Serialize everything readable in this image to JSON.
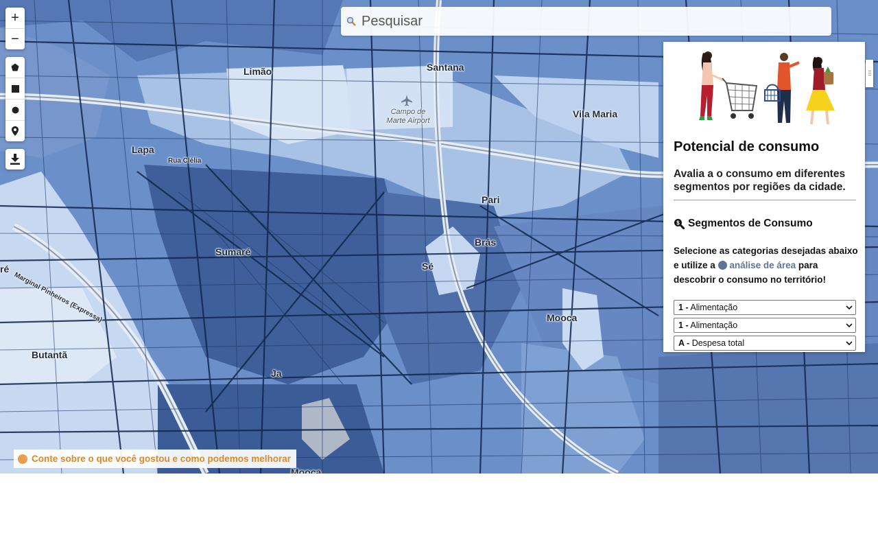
{
  "search": {
    "placeholder": "Pesquisar"
  },
  "map": {
    "places": [
      {
        "name": "Limão",
        "kind": "district"
      },
      {
        "name": "Santana",
        "kind": "district"
      },
      {
        "name": "Vila Maria",
        "kind": "district"
      },
      {
        "name": "Lapa",
        "kind": "district"
      },
      {
        "name": "Rua Clélia",
        "kind": "road"
      },
      {
        "name": "Pari",
        "kind": "district"
      },
      {
        "name": "Brás",
        "kind": "district"
      },
      {
        "name": "Sumaré",
        "kind": "district"
      },
      {
        "name": "Sé",
        "kind": "district"
      },
      {
        "name": "Marginal Pinheiros (Expressa)",
        "kind": "road"
      },
      {
        "name": "Mooca",
        "kind": "district"
      },
      {
        "name": "Butantã",
        "kind": "district"
      },
      {
        "name": "Ja",
        "kind": "district"
      },
      {
        "name": "Mooca",
        "kind": "district"
      },
      {
        "name": "ré",
        "kind": "district"
      }
    ],
    "airport_label": "Campo de Marte Airport",
    "colors": {
      "dark": "#2c4b80",
      "mid": "#5f82bf",
      "light": "#a9c3e8",
      "pale": "#d5e3f5",
      "road": "#0f2447"
    }
  },
  "controls": {
    "zoom_in": "+",
    "zoom_out": "−",
    "draw_tools": [
      "polygon-icon",
      "rectangle-icon",
      "circle-icon",
      "marker-icon"
    ],
    "download": "download-icon"
  },
  "panel": {
    "title": "Potencial de consumo",
    "description": "Avalia a o consumo em diferentes segmentos por regiões da cidade.",
    "section_title": "Segmentos de Consumo",
    "instructions_pre": "Selecione as categorias desejadas abaixo e utilize a",
    "area_link": "análise de área",
    "instructions_post": "para descobrir o consumo no território!",
    "selects": [
      {
        "code": "1 -",
        "label": "Alimentação"
      },
      {
        "code": "1 -",
        "label": "Alimentação"
      },
      {
        "code": "A -",
        "label": "Despesa total"
      }
    ]
  },
  "feedback": {
    "label": "Conte sobre o que você gostou e como podemos melhorar"
  }
}
